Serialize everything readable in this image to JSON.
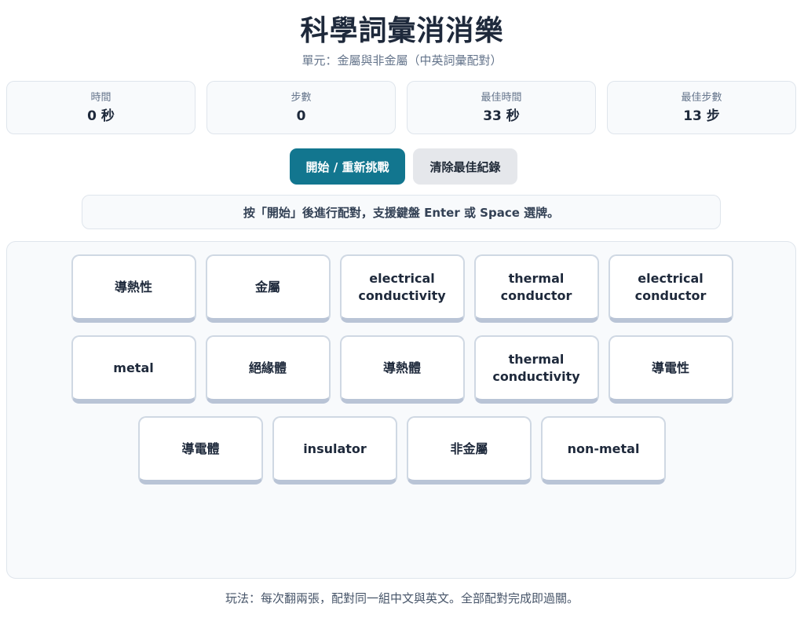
{
  "header": {
    "title": "科學詞彙消消樂",
    "subtitle": "單元：金屬與非金屬（中英詞彙配對）"
  },
  "stats": [
    {
      "label": "時間",
      "value": "0 秒"
    },
    {
      "label": "步數",
      "value": "0"
    },
    {
      "label": "最佳時間",
      "value": "33 秒"
    },
    {
      "label": "最佳步數",
      "value": "13 步"
    }
  ],
  "controls": {
    "start_label": "開始 / 重新挑戰",
    "clear_label": "清除最佳紀錄"
  },
  "message": "按「開始」後進行配對，支援鍵盤 Enter 或 Space 選牌。",
  "cards": [
    "導熱性",
    "金屬",
    "electrical conductivity",
    "thermal conductor",
    "electrical conductor",
    "metal",
    "絕緣體",
    "導熱體",
    "thermal conductivity",
    "導電性",
    "導電體",
    "insulator",
    "非金屬",
    "non-metal"
  ],
  "footer": "玩法：每次翻兩張，配對同一組中文與英文。全部配對完成即過關。"
}
